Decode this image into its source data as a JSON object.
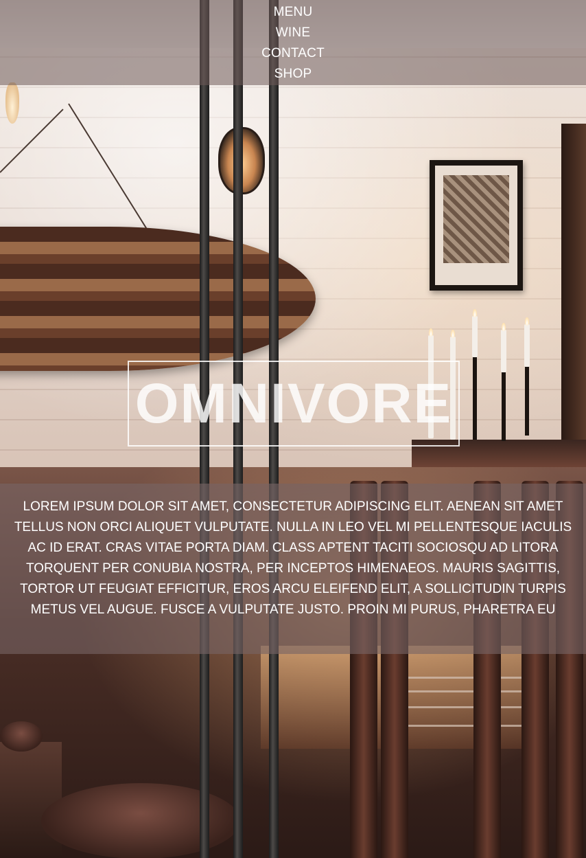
{
  "nav": {
    "items": [
      {
        "label": "MENU"
      },
      {
        "label": "WINE"
      },
      {
        "label": "CONTACT"
      },
      {
        "label": "SHOP"
      }
    ]
  },
  "hero": {
    "logo_text": "OMNIVORE"
  },
  "about": {
    "body": "LOREM IPSUM DOLOR SIT AMET, CONSECTETUR ADIPISCING ELIT. AENEAN SIT AMET TELLUS NON ORCI ALIQUET VULPUTATE. NULLA IN LEO VEL MI PELLENTESQUE IACULIS AC ID ERAT. CRAS VITAE PORTA DIAM. CLASS APTENT TACITI SOCIOSQU AD LITORA TORQUENT PER CONUBIA NOSTRA, PER INCEPTOS HIMENAEOS. MAURIS SAGITTIS, TORTOR UT FEUGIAT EFFICITUR, EROS ARCU ELEIFEND ELIT, A SOLLICITUDIN TURPIS METUS VEL AUGUE. FUSCE A VULPUTATE JUSTO. PROIN MI PURUS, PHARETRA EU"
  },
  "colors": {
    "nav_overlay": "#6e5a58",
    "about_overlay": "#786464",
    "text": "#ffffff"
  }
}
